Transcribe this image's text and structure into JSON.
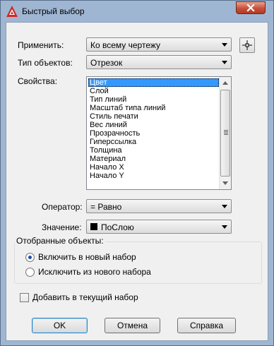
{
  "window": {
    "title": "Быстрый выбор"
  },
  "apply": {
    "label": "Применить:",
    "value": "Ко всему чертежу"
  },
  "object_type": {
    "label": "Тип объектов:",
    "value": "Отрезок"
  },
  "properties": {
    "label": "Свойства:",
    "items": [
      "Цвет",
      "Слой",
      "Тип линий",
      "Масштаб типа линий",
      "Стиль печати",
      "Вес линий",
      "Прозрачность",
      "Гиперссылка",
      "Толщина",
      "Материал",
      "Начало X",
      "Начало Y"
    ],
    "selected_index": 0
  },
  "operator": {
    "label": "Оператор:",
    "value": "= Равно"
  },
  "value": {
    "label": "Значение:",
    "value": "ПоСлою",
    "swatch_color": "#000000"
  },
  "selection_group": {
    "title": "Отобранные объекты:",
    "include_label": "Включить в новый набор",
    "exclude_label": "Исключить из нового набора",
    "selected": "include"
  },
  "append": {
    "label": "Добавить в текущий набор",
    "checked": false
  },
  "buttons": {
    "ok": "OK",
    "cancel": "Отмена",
    "help": "Справка"
  },
  "colors": {
    "selection": "#3399ff",
    "close_button": "#c8503a",
    "frame": "#9fb6d3"
  }
}
